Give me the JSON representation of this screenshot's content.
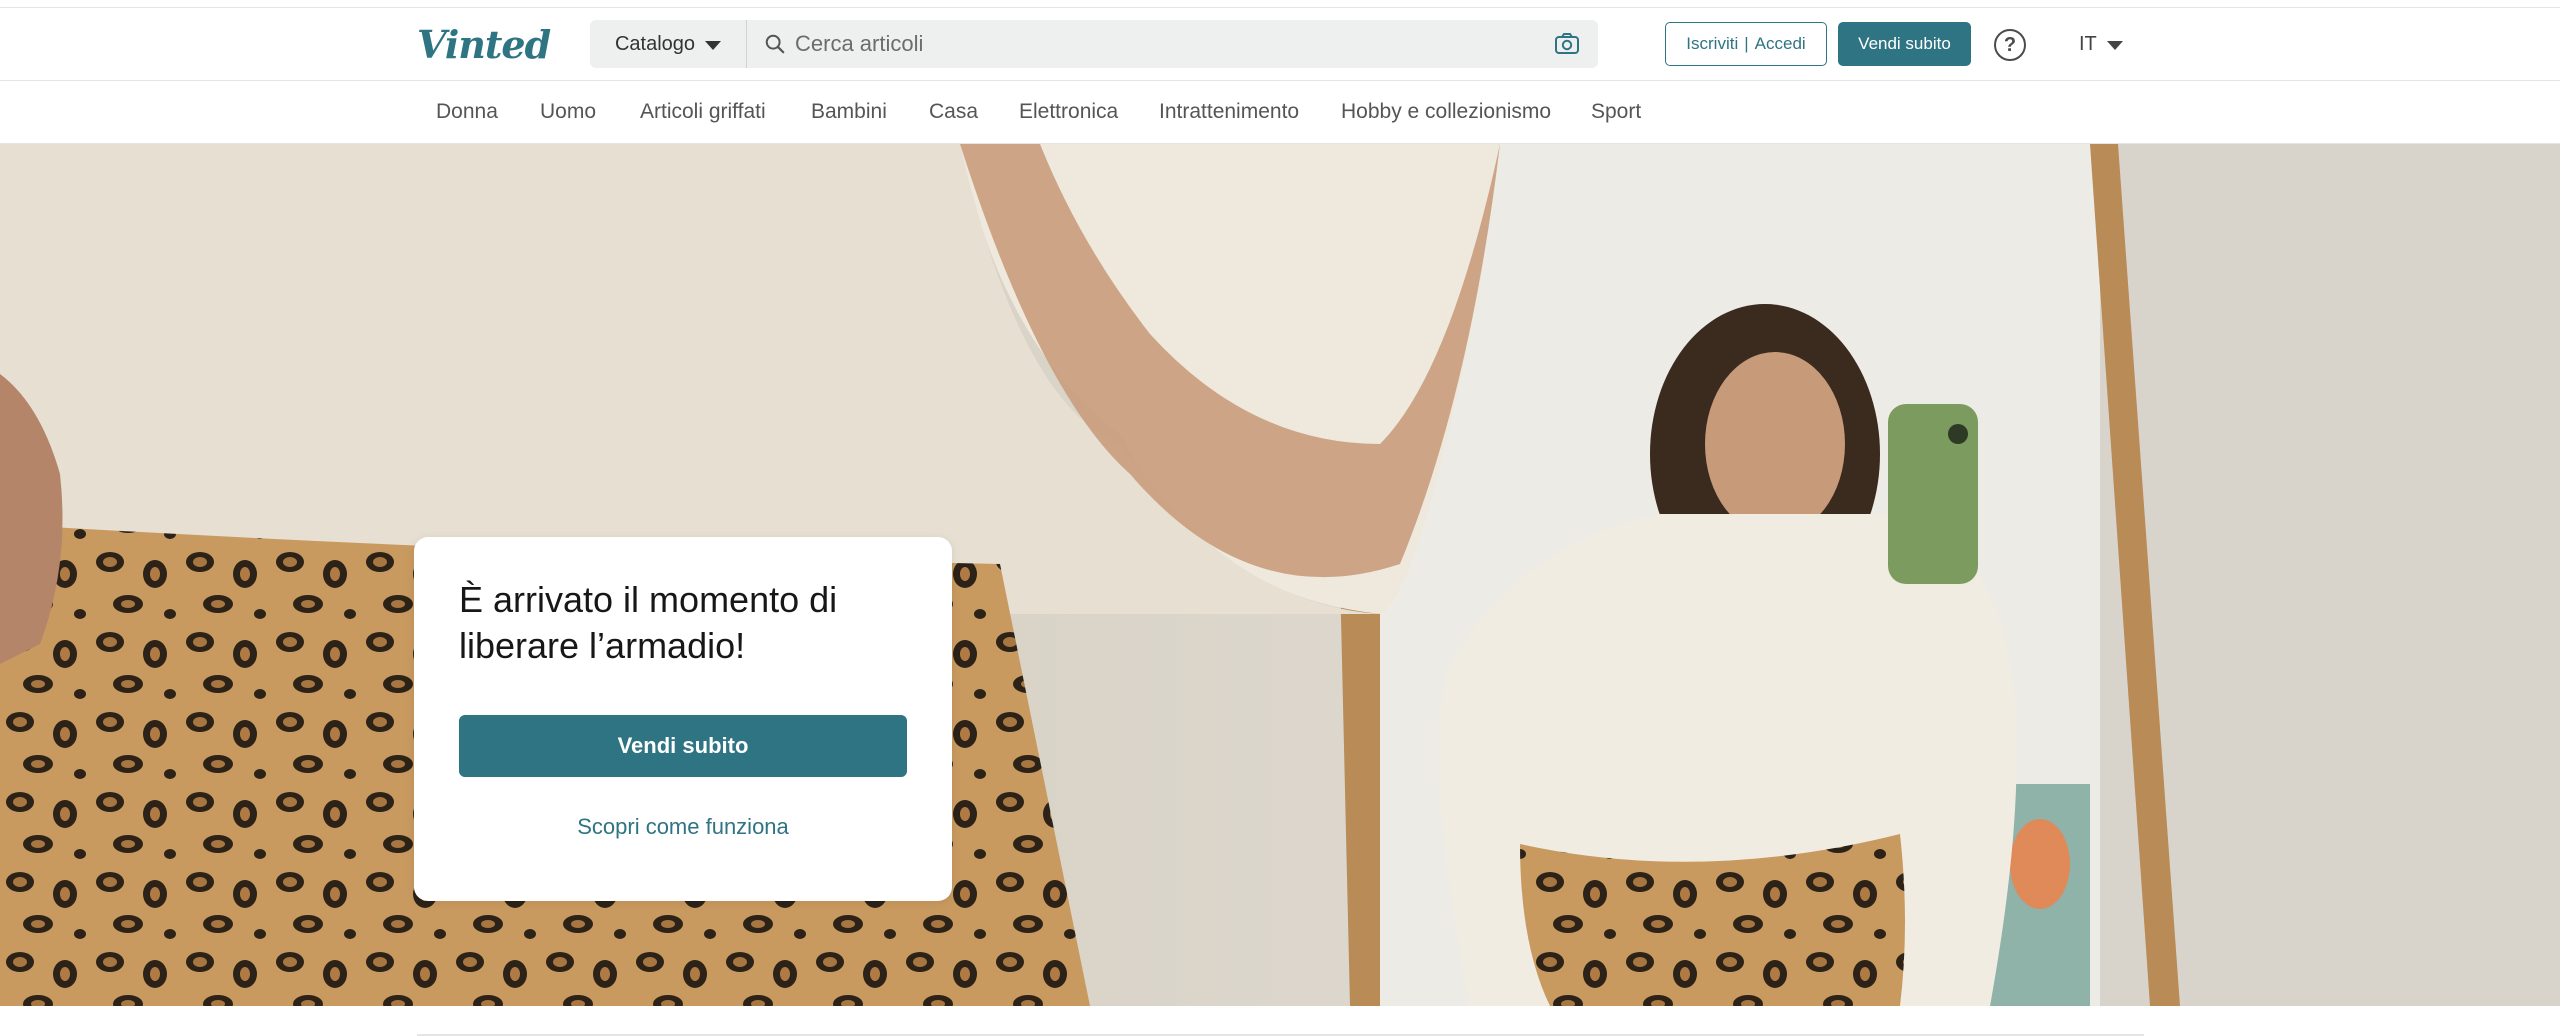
{
  "header": {
    "logo": "Vinted",
    "catalog_label": "Catalogo",
    "search_placeholder": "Cerca articoli",
    "signup_label": "Iscriviti",
    "separator": "|",
    "login_label": "Accedi",
    "sell_label": "Vendi subito",
    "help_label": "?",
    "language": "IT"
  },
  "nav": {
    "items": [
      "Donna",
      "Uomo",
      "Articoli griffati",
      "Bambini",
      "Casa",
      "Elettronica",
      "Intrattenimento",
      "Hobby e collezionismo",
      "Sport"
    ]
  },
  "hero": {
    "title": "È arrivato il momento di liberare l’armadio!",
    "cta_label": "Vendi subito",
    "link_label": "Scopri come funziona"
  },
  "colors": {
    "brand": "#2f7483",
    "text": "#171717",
    "muted": "#555555"
  }
}
